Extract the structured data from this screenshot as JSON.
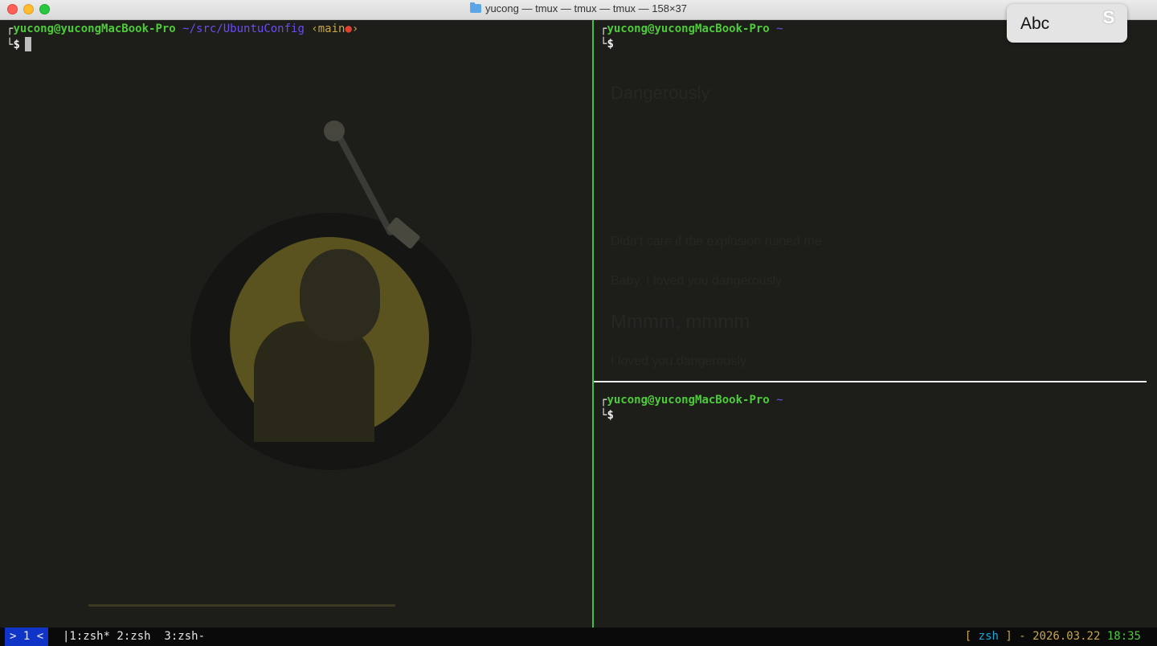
{
  "window": {
    "title": "yucong — tmux — tmux — tmux — 158×37"
  },
  "ime": {
    "label": "Abc",
    "logo_glyph": "S"
  },
  "panes": {
    "left": {
      "corner_top": "┌",
      "corner_bottom": "└",
      "user_host": "yucong@yucongMacBook-Pro",
      "path": "~/src/UbuntuConfig",
      "git_open": "‹main",
      "git_dot": "●",
      "git_close": "›",
      "dollar": "$"
    },
    "right_top": {
      "corner_top": "┌",
      "corner_bottom": "└",
      "user_host": "yucong@yucongMacBook-Pro",
      "path": "~",
      "dollar": "$"
    },
    "right_bottom": {
      "corner_top": "┌",
      "corner_bottom": "└",
      "user_host": "yucong@yucongMacBook-Pro",
      "path": "~",
      "dollar": "$"
    }
  },
  "background_ghost": {
    "song_title": "Dangerously",
    "lyric_1": "Didn't care if the explosion ruined me",
    "lyric_2": "Baby, I loved you dangerously",
    "lyric_3": "Mmmm, mmmm",
    "lyric_4": "I loved you dangerously"
  },
  "statusbar": {
    "session": "> 1 <",
    "windows": "|1:zsh* 2:zsh  3:zsh-",
    "bracket_open": "[ ",
    "shell": "zsh",
    "bracket_close": " ]",
    "separator": " - ",
    "date": "2026.03.22",
    "time": "18:35"
  },
  "colors": {
    "user": "#4ecb3a",
    "path": "#6e4cf0",
    "git": "#c9a64b",
    "git_dot": "#e0412f",
    "pane_divider": "#3fc43f",
    "session_bg": "#1033c8"
  }
}
